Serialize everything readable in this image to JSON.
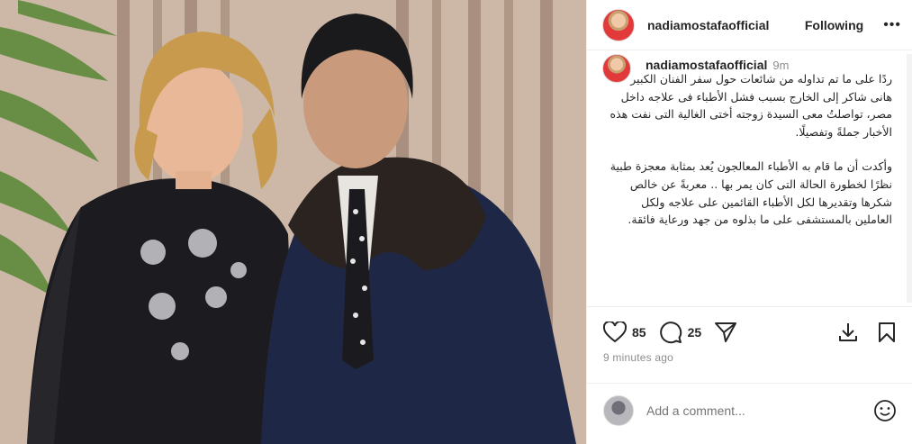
{
  "header": {
    "username": "nadiamostafaofficial",
    "follow_label": "Following",
    "more_label": "•••"
  },
  "caption": {
    "username": "nadiamostafaofficial",
    "time": "9m",
    "paragraphs": [
      "ردًا على ما تم تداوله من شائعات حول سفر الفنان الكبير هانى شاكر إلى الخارج بسبب فشل الأطباء فى علاجه داخل مصر، تواصلتُ معى السيدة زوجته أختى الغالية التى نفت هذه الأخبار جملةً وتفصيلًا.",
      "وأكدت أن ما قام به الأطباء المعالجون يُعد بمثابة معجزة طبية نظرًا لخطورة الحالة التى كان يمر بها .. معربةً عن خالص شكرها وتقديرها لكل الأطباء القائمين على علاجه ولكل العاملين بالمستشفى على ما بذلوه من جهد ورعاية فائقة."
    ]
  },
  "actions": {
    "likes": "85",
    "comments": "25",
    "posted_ago": "9 minutes ago"
  },
  "comment_box": {
    "placeholder": "Add a comment..."
  }
}
